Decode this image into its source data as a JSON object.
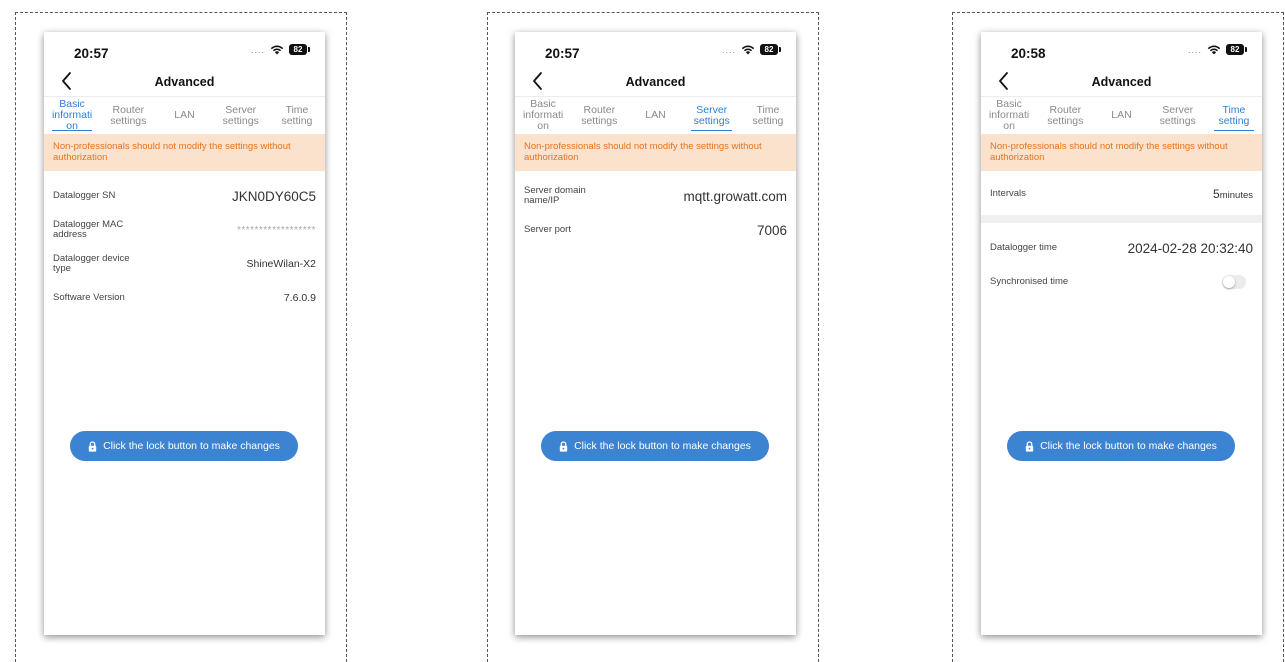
{
  "screens": [
    {
      "time": "20:57",
      "signal": "....",
      "battery": "82",
      "title": "Advanced",
      "tabs": [
        {
          "label": "Basic informati on",
          "active": true
        },
        {
          "label": "Router settings",
          "active": false
        },
        {
          "label": "LAN",
          "active": false
        },
        {
          "label": "Server settings",
          "active": false
        },
        {
          "label": "Time setting",
          "active": false
        }
      ],
      "warning": "Non-professionals should not modify the settings without authorization",
      "rows": [
        {
          "label": "Datalogger SN",
          "value": "JKN0DY60C5"
        },
        {
          "label": "Datalogger MAC address",
          "value": "******************"
        },
        {
          "label": "Datalogger device type",
          "value": "ShineWilan-X2"
        },
        {
          "label": "Software Version",
          "value": "7.6.0.9"
        }
      ],
      "lock_button": "Click the lock button to make changes"
    },
    {
      "time": "20:57",
      "signal": "....",
      "battery": "82",
      "title": "Advanced",
      "tabs": [
        {
          "label": "Basic informati on",
          "active": false
        },
        {
          "label": "Router settings",
          "active": false
        },
        {
          "label": "LAN",
          "active": false
        },
        {
          "label": "Server settings",
          "active": true
        },
        {
          "label": "Time setting",
          "active": false
        }
      ],
      "warning": "Non-professionals should not modify the settings without authorization",
      "rows": [
        {
          "label": "Server domain name/IP",
          "value": "mqtt.growatt.com"
        },
        {
          "label": "Server port",
          "value": "7006"
        }
      ],
      "lock_button": "Click the lock button to make changes"
    },
    {
      "time": "20:58",
      "signal": "....",
      "battery": "82",
      "title": "Advanced",
      "tabs": [
        {
          "label": "Basic informati on",
          "active": false
        },
        {
          "label": "Router settings",
          "active": false
        },
        {
          "label": "LAN",
          "active": false
        },
        {
          "label": "Server settings",
          "active": false
        },
        {
          "label": "Time setting",
          "active": true
        }
      ],
      "warning": "Non-professionals should not modify the settings without authorization",
      "intervals": {
        "label": "Intervals",
        "value": "5",
        "unit": "minutes"
      },
      "datalogger_time": {
        "label": "Datalogger time",
        "value": "2024-02-28 20:32:40"
      },
      "synchronised_time": {
        "label": "Synchronised time",
        "enabled": false
      },
      "lock_button": "Click the lock button to make changes"
    }
  ],
  "colors": {
    "accent": "#2d7fd3",
    "button": "#3c83d1",
    "warning_bg": "#fbe2cd",
    "warning_text": "#e8731c"
  }
}
